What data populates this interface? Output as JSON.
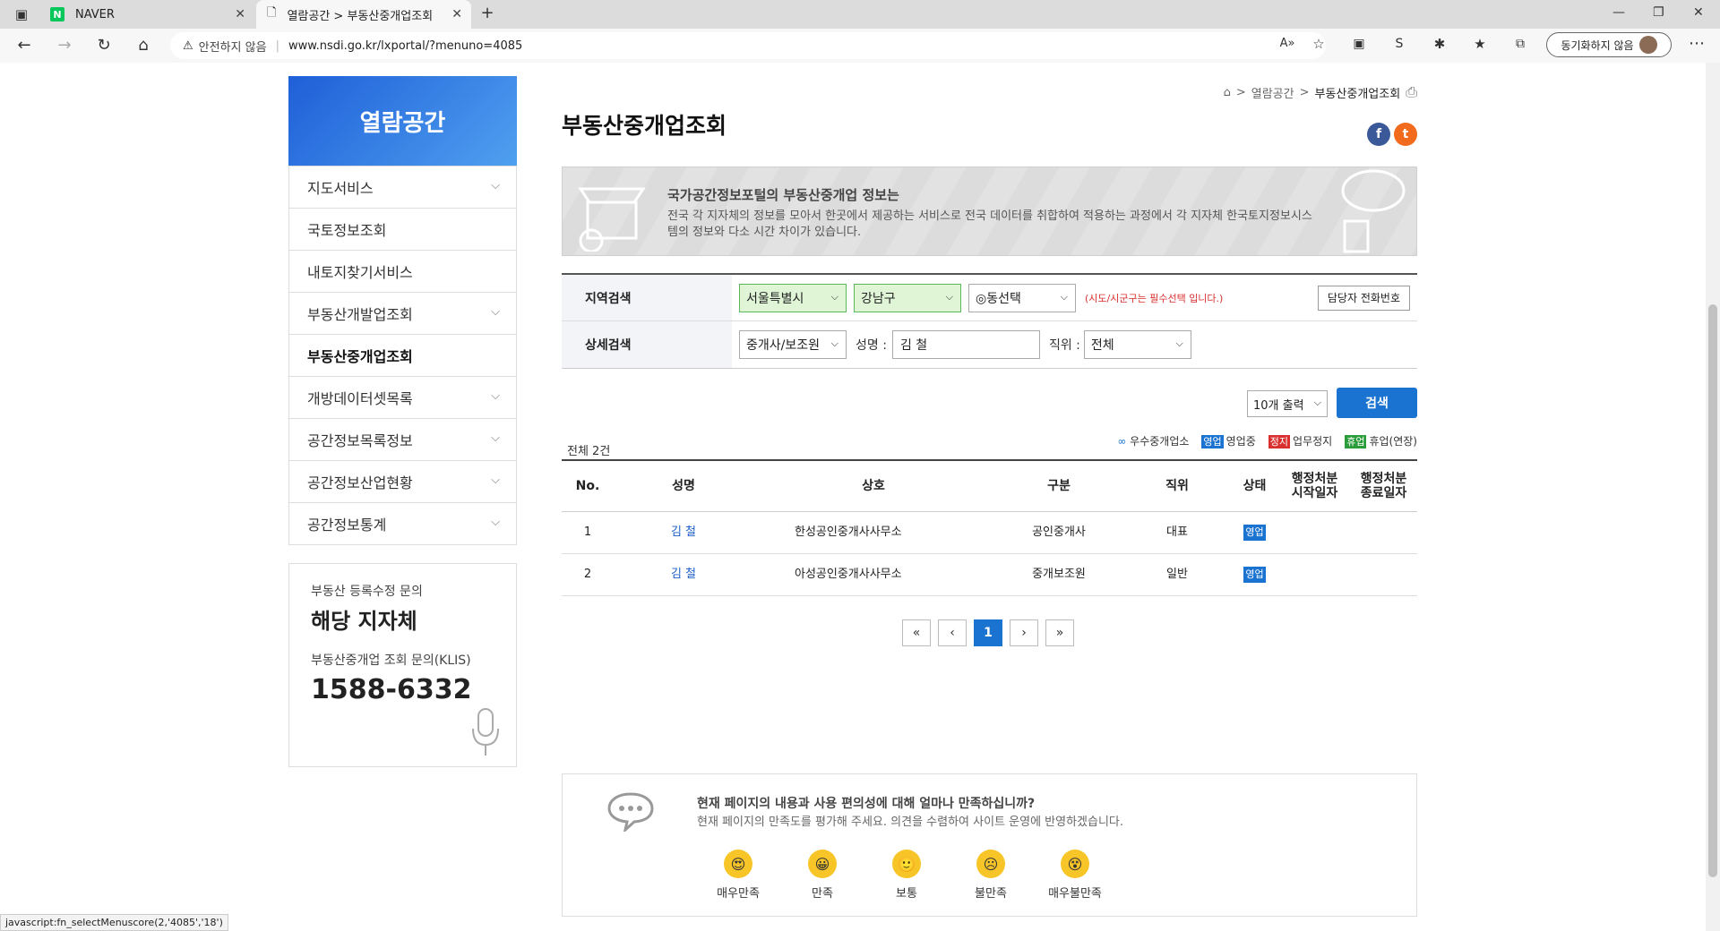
{
  "browser": {
    "tab1_title": "NAVER",
    "tab2_title": "열람공간 > 부동산중개업조회",
    "security_label": "안전하지 않음",
    "url": "www.nsdi.go.kr/lxportal/?menuno=4085",
    "sync_label": "동기화하지 않음",
    "status_url": "javascript:fn_selectMenuscore(2,'4085','18')"
  },
  "sidebar": {
    "title": "열람공간",
    "items": [
      {
        "label": "지도서비스"
      },
      {
        "label": "국토정보조회"
      },
      {
        "label": "내토지찾기서비스"
      },
      {
        "label": "부동산개발업조회"
      },
      {
        "label": "부동산중개업조회"
      },
      {
        "label": "개방데이터셋목록"
      },
      {
        "label": "공간정보목록정보"
      },
      {
        "label": "공간정보산업현황"
      },
      {
        "label": "공간정보통계"
      }
    ],
    "contact": {
      "line1": "부동산 등록수정 문의",
      "line2": "해당 지자체",
      "line3": "부동산중개업 조회 문의(KLIS)",
      "phone": "1588-6332"
    }
  },
  "main": {
    "breadcrumb": [
      "열람공간",
      "부동산중개업조회"
    ],
    "title": "부동산중개업조회",
    "banner_title": "국가공간정보포털의 부동산중개업 정보는",
    "banner_text": "전국 각 지자체의 정보를 모아서 한곳에서 제공하는 서비스로 전국 데이터를 취합하여 적용하는 과정에서 각 지자체 한국토지정보시스템의 정보와 다소 시간 차이가 있습니다."
  },
  "search": {
    "region_label": "지역검색",
    "sido": "서울특별시",
    "sigungu": "강남구",
    "dong": "◎동선택",
    "required_note": "(시도/시군구는 필수선택 입니다.)",
    "tel_button": "담당자 전화번호",
    "detail_label": "상세검색",
    "type": "중개사/보조원",
    "name_label": "성명 :",
    "name_value": "김   철",
    "position_label": "직위 :",
    "position_value": "전체",
    "count_select": "10개 출력",
    "search_button": "검색"
  },
  "results": {
    "total": "전체 2건",
    "legend": {
      "excellent": "우수중개업소",
      "open_badge": "영업",
      "open": "영업중",
      "stop_badge": "정지",
      "stop": "업무정지",
      "rest_badge": "휴업",
      "rest": "휴업(연장)"
    },
    "columns": [
      "No.",
      "성명",
      "상호",
      "구분",
      "직위",
      "상태",
      "행정처분\n시작일자",
      "행정처분\n종료일자"
    ],
    "rows": [
      {
        "no": "1",
        "name": "김   철",
        "company": "한성공인중개사사무소",
        "type": "공인중개사",
        "position": "대표",
        "status": "영업"
      },
      {
        "no": "2",
        "name": "김   철",
        "company": "아성공인중개사사무소",
        "type": "중개보조원",
        "position": "일반",
        "status": "영업"
      }
    ],
    "pager": [
      "«",
      "‹",
      "1",
      "›",
      "»"
    ]
  },
  "survey": {
    "question": "현재 페이지의 내용과 사용 편의성에 대해 얼마나 만족하십니까?",
    "sub": "현재 페이지의 만족도를 평가해 주세요. 의견을 수렴하여 사이트 운영에 반영하겠습니다.",
    "options": [
      "매우만족",
      "만족",
      "보통",
      "불만족",
      "매우불만족"
    ]
  },
  "colors": {
    "accent": "#1a73d1",
    "stop": "#d9302f",
    "rest": "#2a9d3a"
  }
}
